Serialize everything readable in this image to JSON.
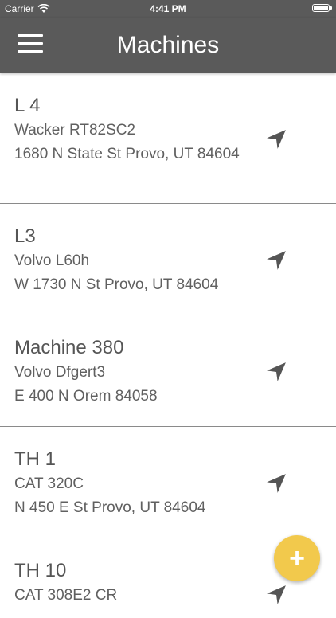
{
  "status_bar": {
    "carrier": "Carrier",
    "time": "4:41 PM",
    "wifi_icon": "wifi-icon",
    "battery_level": 1.0
  },
  "header": {
    "title": "Machines",
    "menu_icon": "hamburger-menu-icon"
  },
  "machines": [
    {
      "name": "L 4",
      "model": "Wacker RT82SC2",
      "address": "1680 N State St Provo, UT 84604",
      "icon": "navigation-arrow-icon"
    },
    {
      "name": "L3",
      "model": "Volvo L60h",
      "address": "W 1730 N St Provo, UT 84604",
      "icon": "navigation-arrow-icon"
    },
    {
      "name": "Machine 380",
      "model": "Volvo Dfgert3",
      "address": "E 400 N Orem 84058",
      "icon": "navigation-arrow-icon"
    },
    {
      "name": "TH 1",
      "model": "CAT 320C",
      "address": "N 450 E St Provo, UT 84604",
      "icon": "navigation-arrow-icon"
    },
    {
      "name": "TH 10",
      "model": "CAT 308E2 CR",
      "address": "",
      "icon": "navigation-arrow-icon"
    }
  ],
  "fab": {
    "label": "+",
    "icon": "plus-icon",
    "color": "#f2c94c"
  },
  "colors": {
    "header_bg": "#5a5a5a",
    "text": "#555555",
    "divider": "#8a8a8a"
  }
}
